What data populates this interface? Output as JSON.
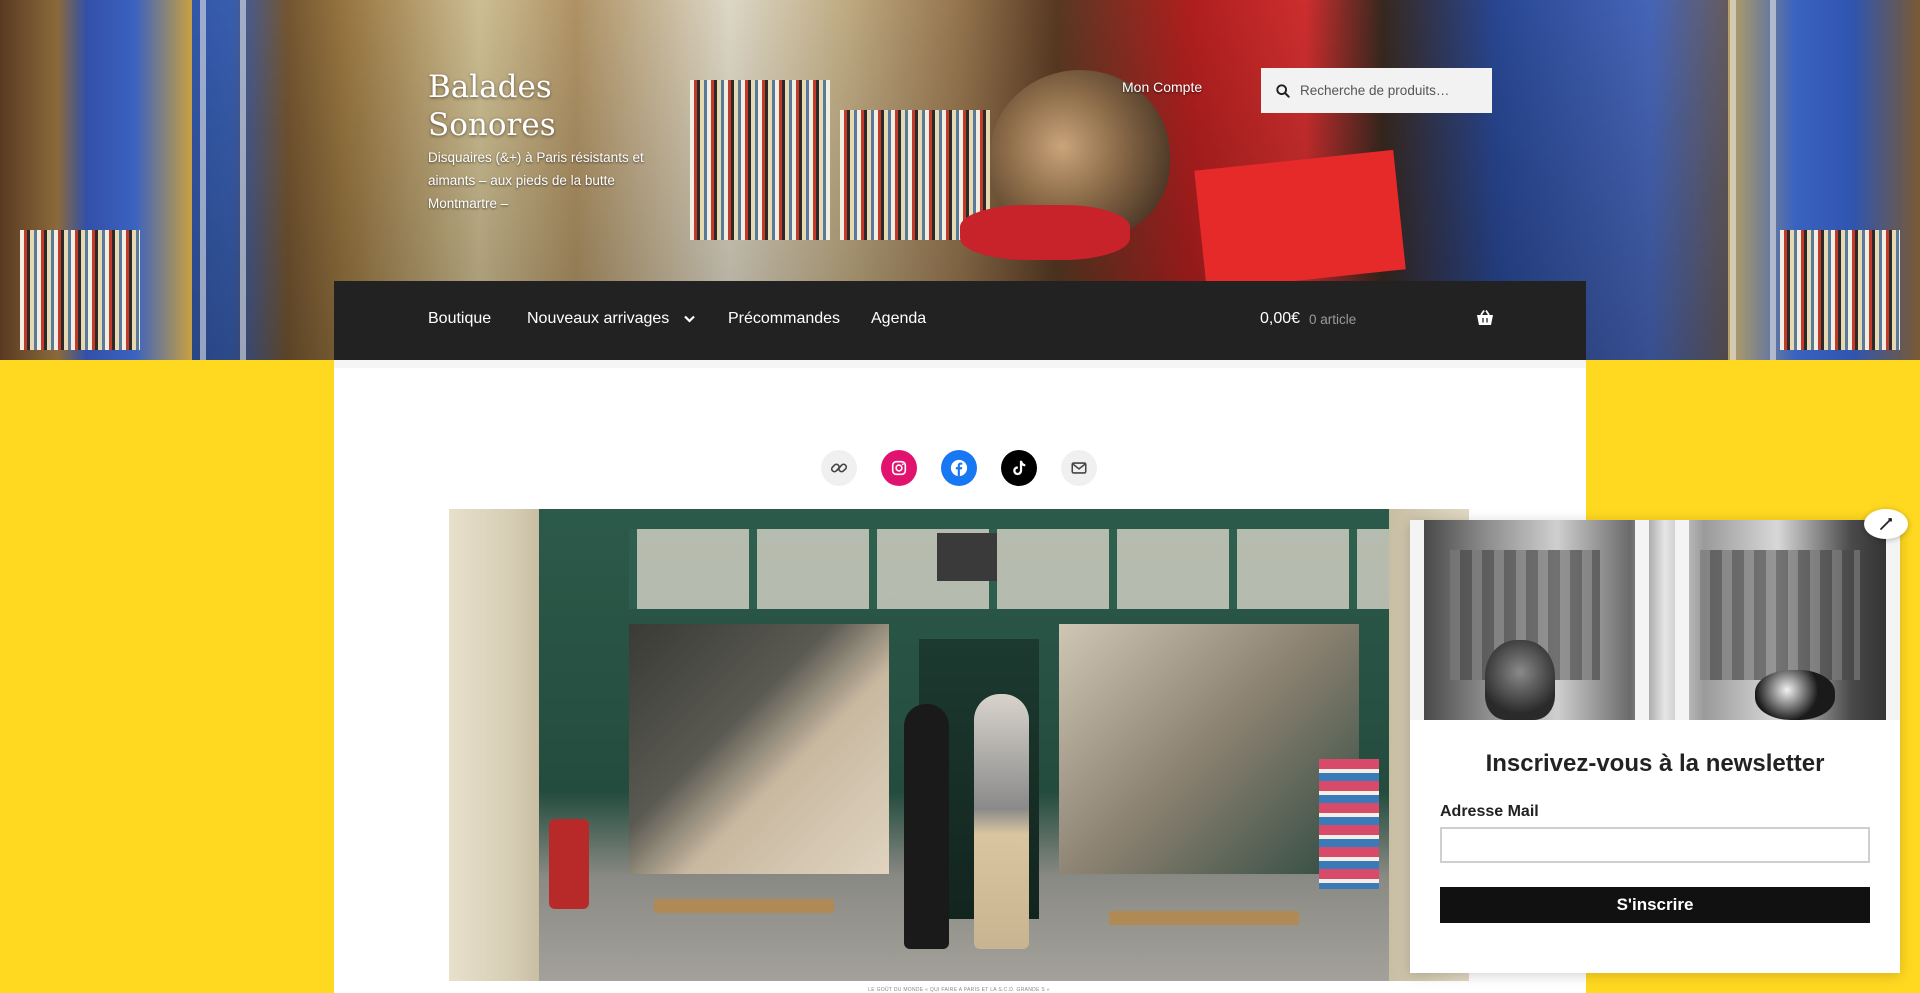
{
  "header": {
    "site_title": "Balades Sonores",
    "tagline": "Disquaires (&+) à Paris résistants et aimants – aux pieds de la butte Montmartre –",
    "account_link": "Mon Compte",
    "search": {
      "placeholder": "Recherche de produits…",
      "value": "",
      "icon": "search-icon"
    },
    "banner_image": "header-photo-cat-record-shop"
  },
  "nav": {
    "items": [
      {
        "label": "Boutique"
      },
      {
        "label": "Nouveaux arrivages",
        "has_dropdown": true,
        "icon": "chevron-down-icon"
      },
      {
        "label": "Précommandes"
      },
      {
        "label": "Agenda"
      }
    ],
    "cart": {
      "total": "0,00€",
      "count": "0 article",
      "icon": "basket-icon"
    }
  },
  "social": [
    {
      "name": "link",
      "icon": "link-icon",
      "color": "#f0f0f0"
    },
    {
      "name": "instagram",
      "icon": "instagram-icon",
      "color": "#e2126f"
    },
    {
      "name": "facebook",
      "icon": "facebook-icon",
      "color": "#1877f2"
    },
    {
      "name": "tiktok",
      "icon": "tiktok-icon",
      "color": "#000000"
    },
    {
      "name": "mail",
      "icon": "mail-icon",
      "color": "#f0f0f0"
    }
  ],
  "main": {
    "hero_image": "shop-storefront-photo",
    "caption": "LE GOÛT DU MONDE « QUI FAIRE A PARIS ET LA S.C.D. GRANDE S »"
  },
  "popup": {
    "title": "Inscrivez-vous à la newsletter",
    "email_label": "Adresse Mail",
    "email_value": "",
    "submit_label": "S'inscrire",
    "close_icon": "close-icon",
    "image": "cats-at-window-photo"
  },
  "colors": {
    "page_background": "#FFD820",
    "nav_background": "#222222",
    "content_background": "#ffffff",
    "button_background": "#111111",
    "instagram": "#e2126f",
    "facebook": "#1877f2"
  }
}
